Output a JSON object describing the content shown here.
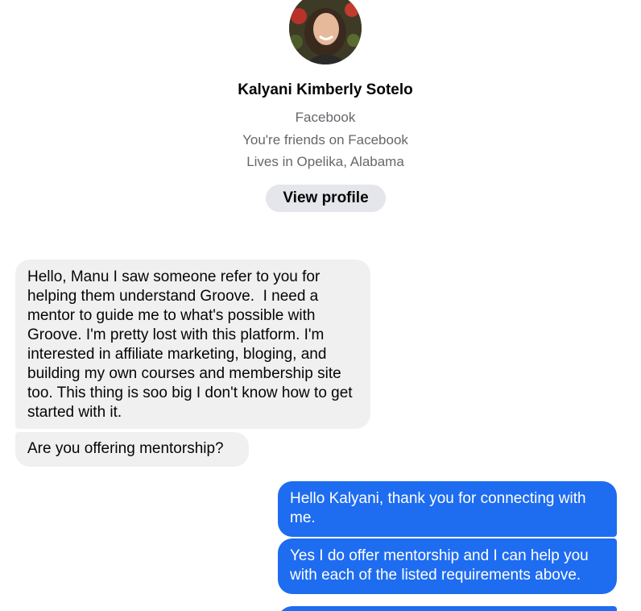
{
  "profile": {
    "name": "Kalyani Kimberly Sotelo",
    "platform": "Facebook",
    "friendship": "You're friends on Facebook",
    "location": "Lives in Opelika, Alabama",
    "view_profile_label": "View profile"
  },
  "messages": [
    {
      "direction": "incoming",
      "text": "Hello, Manu I saw someone refer to you for helping them understand Groove.  I need a mentor to guide me to what's possible with Groove. I'm pretty lost with this platform. I'm interested in affiliate marketing, bloging, and building my own courses and membership site too. This thing is soo big I don't know how to get started with it."
    },
    {
      "direction": "incoming",
      "text": "Are you offering mentorship?"
    },
    {
      "direction": "outgoing",
      "text": "Hello Kalyani, thank you for connecting with me."
    },
    {
      "direction": "outgoing",
      "text": "Yes I do offer mentorship and I can help you with each of the listed requirements above."
    },
    {
      "direction": "outgoing",
      "text": ""
    }
  ],
  "colors": {
    "outgoing_bubble": "#1e6cf0",
    "incoming_bubble": "#f0f0f0",
    "secondary_text": "#65676b"
  }
}
